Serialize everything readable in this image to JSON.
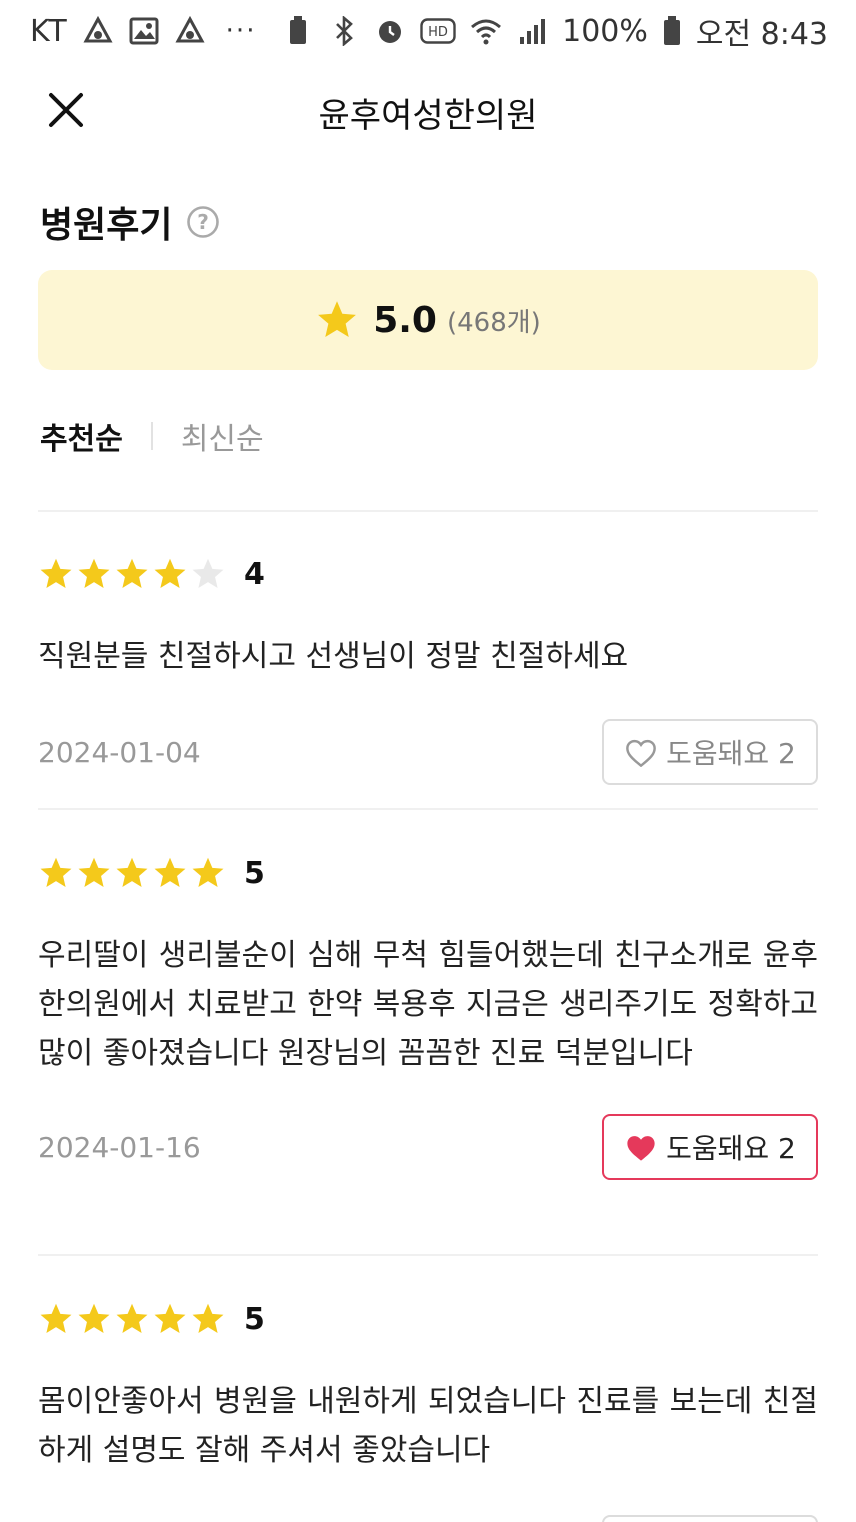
{
  "status_bar": {
    "carrier": "KT",
    "dots": "···",
    "hd": "HD",
    "battery_pct": "100%",
    "clock": "오전 8:43"
  },
  "header": {
    "title": "윤후여성한의원"
  },
  "section": {
    "title": "병원후기"
  },
  "rating": {
    "value": "5.0",
    "count": "(468개)"
  },
  "sort": {
    "tabs": [
      "추천순",
      "최신순"
    ],
    "selected": "추천순"
  },
  "colors": {
    "star": "#f4c91b",
    "star_empty": "#e9e9e9",
    "heart": "#e5395b",
    "rating_bg": "#fdf6d3"
  },
  "reviews": [
    {
      "stars": 4,
      "score": "4",
      "text": "직원분들 친절하시고 선생님이 정말 친절하세요",
      "date": "2024-01-04",
      "helpful_label": "도움돼요 2",
      "helpful_active": false
    },
    {
      "stars": 5,
      "score": "5",
      "text": "우리딸이 생리불순이 심해 무척 힘들어했는데 친구소개로 윤후한의원에서 치료받고 한약 복용후 지금은 생리주기도 정확하고 많이 좋아졌습니다 원장님의 꼼꼼한 진료 덕분입니다",
      "date": "2024-01-16",
      "helpful_label": "도움돼요 2",
      "helpful_active": true
    },
    {
      "stars": 5,
      "score": "5",
      "text": "몸이안좋아서 병원을 내원하게 되었습니다 진료를 보는데 친절하게 설명도 잘해 주셔서 좋았습니다",
      "helpful_active": false
    }
  ]
}
